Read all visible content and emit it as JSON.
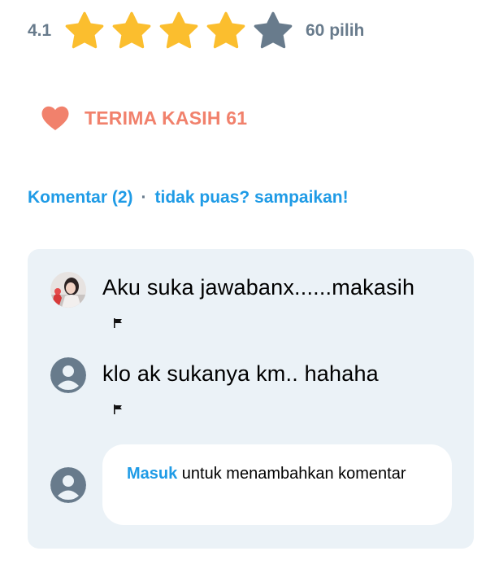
{
  "rating": {
    "value": "4.1",
    "stars_filled": 4,
    "stars_total": 5,
    "votes_label": "60 pilih",
    "colors": {
      "filled": "#fbbe2e",
      "empty": "#687b8c"
    },
    "icon": "star-icon"
  },
  "thanks": {
    "label": "TERIMA KASIH 61",
    "icon": "heart-icon",
    "color": "#f1816c"
  },
  "links": {
    "comments_label": "Komentar (2)",
    "separator": "·",
    "report_label": "tidak puas? sampaikan!",
    "color": "#1f9be6"
  },
  "comments": [
    {
      "text": "Aku suka jawabanx......makasih",
      "avatar": "user-photo",
      "flag_icon": "flag-icon"
    },
    {
      "text": "klo ak sukanya km.. hahaha",
      "avatar": "default-avatar-icon",
      "flag_icon": "flag-icon"
    }
  ],
  "add_comment": {
    "login_link": "Masuk",
    "prompt": " untuk menambahkan komentar",
    "avatar": "default-avatar-icon"
  }
}
